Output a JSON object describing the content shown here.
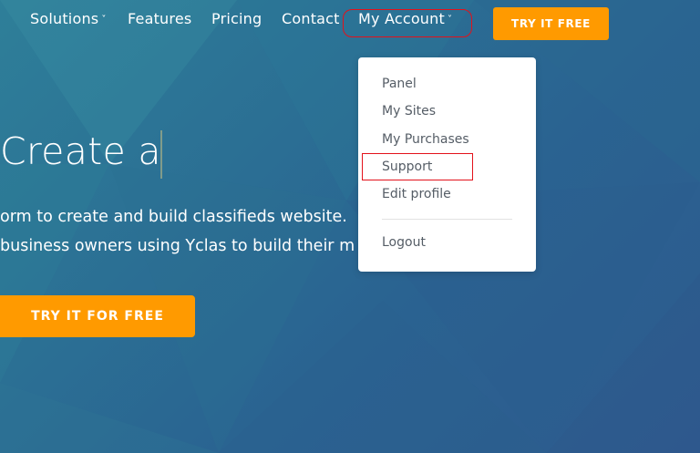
{
  "nav": {
    "solutions": "Solutions",
    "features": "Features",
    "pricing": "Pricing",
    "contact": "Contact",
    "my_account": "My Account",
    "chevron": "˅",
    "try_button": "TRY IT FREE"
  },
  "account_menu": {
    "items": [
      "Panel",
      "My Sites",
      "My Purchases",
      "Support",
      "Edit profile"
    ],
    "logout": "Logout"
  },
  "hero": {
    "title": "Create a",
    "line1": "orm to create and build classifieds website.",
    "line2": "business owners using Yclas to build their m",
    "cta": "TRY IT FOR FREE"
  },
  "colors": {
    "accent": "#ff9a00",
    "background": "#2b6f94",
    "highlight": "#e3121b"
  },
  "icons": {
    "solutions_chevron": "chevron-down-icon",
    "account_chevron": "chevron-down-icon"
  }
}
